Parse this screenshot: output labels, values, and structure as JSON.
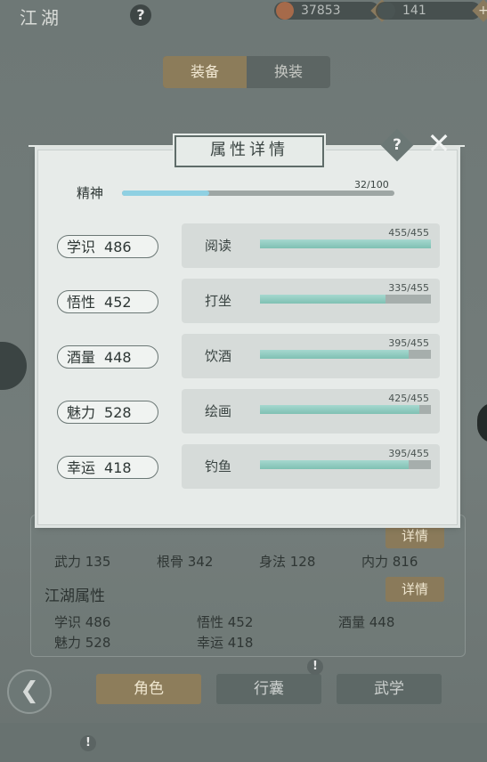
{
  "header": {
    "title": "江湖",
    "help": "?",
    "currency_a": "37853",
    "currency_b": "141",
    "plus": "+"
  },
  "tabs": {
    "equip": "装备",
    "change": "换装"
  },
  "modal": {
    "title": "属性详情",
    "help": "?",
    "close": "✕",
    "spirit": {
      "label": "精神",
      "current": 32,
      "max": 100,
      "text": "32/100"
    },
    "attributes": [
      {
        "label": "学识",
        "value": "486"
      },
      {
        "label": "悟性",
        "value": "452"
      },
      {
        "label": "酒量",
        "value": "448"
      },
      {
        "label": "魅力",
        "value": "528"
      },
      {
        "label": "幸运",
        "value": "418"
      }
    ],
    "skills": [
      {
        "name": "阅读",
        "current": 455,
        "max": 455,
        "text": "455/455"
      },
      {
        "name": "打坐",
        "current": 335,
        "max": 455,
        "text": "335/455"
      },
      {
        "name": "饮酒",
        "current": 395,
        "max": 455,
        "text": "395/455"
      },
      {
        "name": "绘画",
        "current": 425,
        "max": 455,
        "text": "425/455"
      },
      {
        "name": "钓鱼",
        "current": 395,
        "max": 455,
        "text": "395/455"
      }
    ]
  },
  "lower": {
    "detail_label": "详情",
    "combat_stats": [
      {
        "text": "武力 135"
      },
      {
        "text": "根骨 342"
      },
      {
        "text": "身法 128"
      },
      {
        "text": "内力 816"
      }
    ],
    "jianghu_title": "江湖属性",
    "jianghu_stats": [
      {
        "text": "学识 486"
      },
      {
        "text": "悟性 452"
      },
      {
        "text": "酒量 448"
      },
      {
        "text": "魅力 528"
      },
      {
        "text": "幸运 418"
      }
    ]
  },
  "nav": {
    "role": "角色",
    "bag": "行囊",
    "martial": "武学",
    "back": "❮",
    "excl": "!"
  },
  "colors": {
    "accent_gold": "#8c7c5a",
    "bar_fill": "#7fc0b3",
    "spirit_fill": "#8fd0e2"
  }
}
